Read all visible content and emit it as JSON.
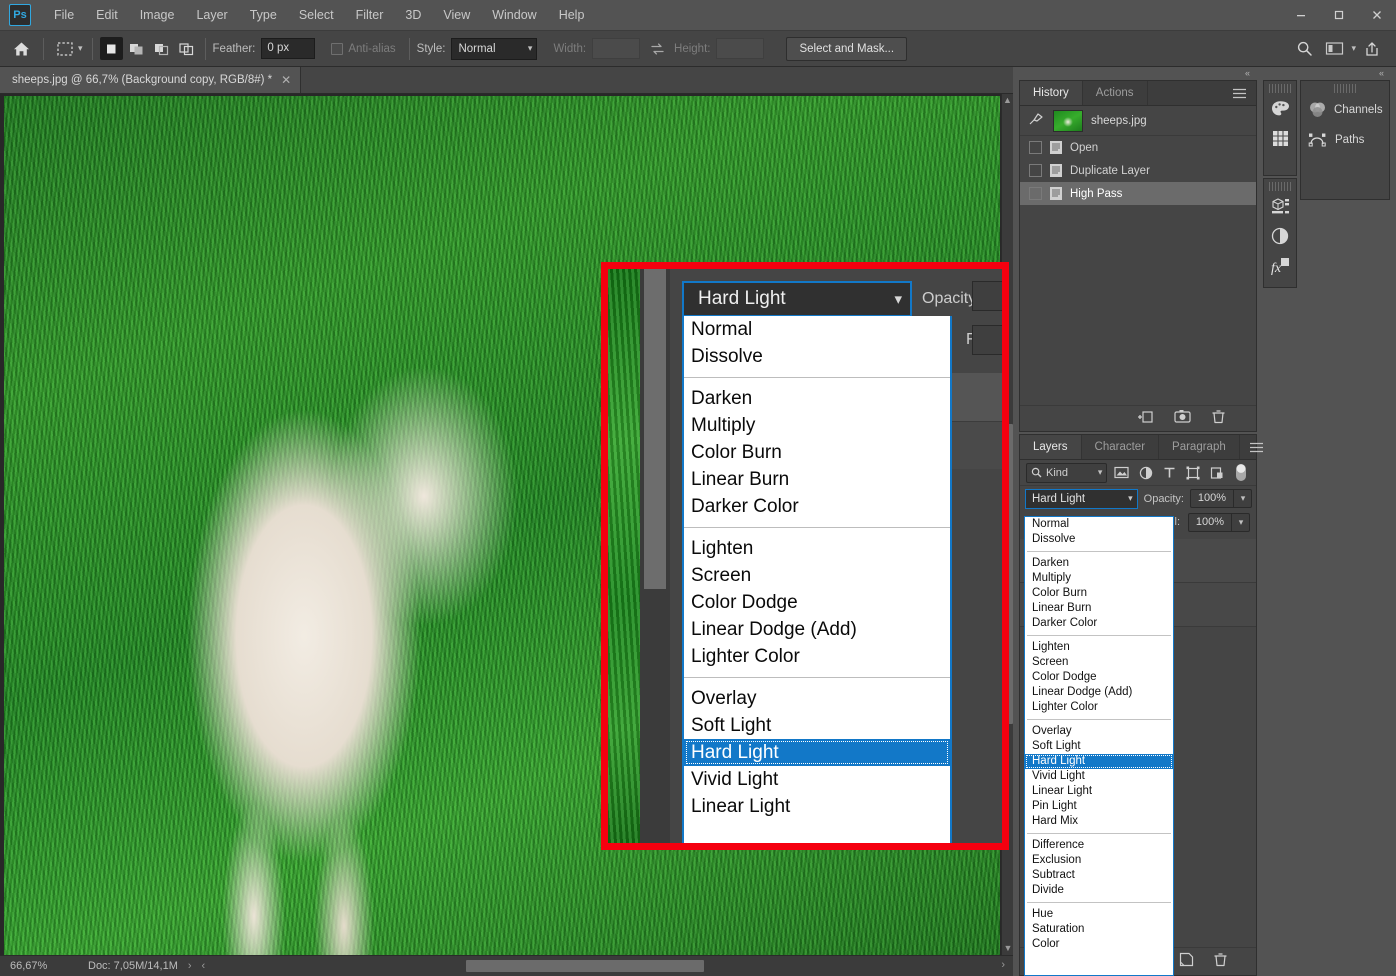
{
  "app": {
    "logo": "Ps"
  },
  "menubar": {
    "items": [
      "File",
      "Edit",
      "Image",
      "Layer",
      "Type",
      "Select",
      "Filter",
      "3D",
      "View",
      "Window",
      "Help"
    ]
  },
  "window_controls": {
    "minimize": "—",
    "maximize": "□",
    "close": "✕"
  },
  "options_bar": {
    "home_icon": "home-icon",
    "tool_icon": "rectangular-marquee-icon",
    "selection_modes": [
      "new-selection",
      "add-to-selection",
      "subtract-from-selection",
      "intersect-with-selection"
    ],
    "feather_label": "Feather:",
    "feather_value": "0 px",
    "antialias_label": "Anti-alias",
    "antialias_checked": false,
    "style_label": "Style:",
    "style_value": "Normal",
    "width_label": "Width:",
    "width_value": "",
    "height_label": "Height:",
    "height_value": "",
    "swap_icon": "swap-dimensions-icon",
    "select_and_mask": "Select and Mask...",
    "right_icons": [
      "search-icon",
      "workspace-arrange-icon",
      "chevron-down-icon",
      "share-icon"
    ]
  },
  "document_tab": {
    "title": "sheeps.jpg @ 66,7% (Background copy, RGB/8#) *",
    "close": "✕"
  },
  "status_bar": {
    "zoom": "66,67%",
    "doc": "Doc: 7,05M/14,1M",
    "expand_arrow": "›",
    "collapse_arrow": "‹",
    "scroll_right_arrow": "›"
  },
  "history_panel": {
    "tabs": [
      {
        "label": "History",
        "active": true
      },
      {
        "label": "Actions",
        "active": false
      }
    ],
    "menu_icon": "panel-menu-icon",
    "snapshot": {
      "label": "sheeps.jpg",
      "brush_icon": "history-brush-icon",
      "thumb": "document-thumbnail"
    },
    "states": [
      {
        "label": "Open",
        "selected": false
      },
      {
        "label": "Duplicate Layer",
        "selected": false
      },
      {
        "label": "High Pass",
        "selected": true
      }
    ],
    "footer_icons": [
      "new-document-from-state-icon",
      "create-snapshot-icon",
      "delete-state-icon"
    ]
  },
  "layers_panel": {
    "tabs": [
      {
        "label": "Layers",
        "active": true
      },
      {
        "label": "Character",
        "active": false
      },
      {
        "label": "Paragraph",
        "active": false
      }
    ],
    "menu_icon": "panel-menu-icon",
    "filter": {
      "kind_label": "Kind",
      "search_icon": "search-icon",
      "chevron": "∨",
      "icons": [
        "filter-pixel-icon",
        "filter-adjustment-icon",
        "filter-type-icon",
        "filter-shape-icon",
        "filter-smart-object-icon"
      ],
      "toggle_icon": "filter-toggle-switch"
    },
    "blend_mode": "Hard Light",
    "blend_chevron": "∨",
    "opacity_label": "Opacity:",
    "opacity_value": "100%",
    "fill_label": "Fill:",
    "fill_value": "100%",
    "lock_icon": "lock-icon",
    "footer_icons": [
      "new-layer-icon",
      "delete-layer-icon"
    ],
    "blend_options": [
      {
        "label": "Normal"
      },
      {
        "label": "Dissolve"
      },
      {
        "separator": true
      },
      {
        "label": "Darken"
      },
      {
        "label": "Multiply"
      },
      {
        "label": "Color Burn"
      },
      {
        "label": "Linear Burn"
      },
      {
        "label": "Darker Color"
      },
      {
        "separator": true
      },
      {
        "label": "Lighten"
      },
      {
        "label": "Screen"
      },
      {
        "label": "Color Dodge"
      },
      {
        "label": "Linear Dodge (Add)"
      },
      {
        "label": "Lighter Color"
      },
      {
        "separator": true
      },
      {
        "label": "Overlay"
      },
      {
        "label": "Soft Light"
      },
      {
        "label": "Hard Light",
        "selected": true
      },
      {
        "label": "Vivid Light"
      },
      {
        "label": "Linear Light"
      },
      {
        "label": "Pin Light"
      },
      {
        "label": "Hard Mix"
      },
      {
        "separator": true
      },
      {
        "label": "Difference"
      },
      {
        "label": "Exclusion"
      },
      {
        "label": "Subtract"
      },
      {
        "label": "Divide"
      },
      {
        "separator": true
      },
      {
        "label": "Hue"
      },
      {
        "label": "Saturation"
      },
      {
        "label": "Color"
      }
    ]
  },
  "collapsed_panels": {
    "tabs": [
      {
        "label": "Channels",
        "icon": "channels-icon"
      },
      {
        "label": "Paths",
        "icon": "paths-icon"
      }
    ],
    "collapse_arrows": "«"
  },
  "icon_rail": {
    "groups": [
      [
        "color-palette-icon",
        "swatches-grid-icon"
      ],
      [
        "3d-properties-icon",
        "adjustments-icon",
        "layer-styles-fx-icon"
      ]
    ]
  },
  "callout": {
    "border_color": "#f5000f",
    "blend_mode": "Hard Light",
    "blend_chevron": "∨",
    "opacity_label": "Opacity:",
    "fill_label": "Fill:",
    "options": [
      {
        "label": "Normal"
      },
      {
        "label": "Dissolve"
      },
      {
        "separator": true
      },
      {
        "label": "Darken"
      },
      {
        "label": "Multiply"
      },
      {
        "label": "Color Burn"
      },
      {
        "label": "Linear Burn"
      },
      {
        "label": "Darker Color"
      },
      {
        "separator": true
      },
      {
        "label": "Lighten"
      },
      {
        "label": "Screen"
      },
      {
        "label": "Color Dodge"
      },
      {
        "label": "Linear Dodge (Add)"
      },
      {
        "label": "Lighter Color"
      },
      {
        "separator": true
      },
      {
        "label": "Overlay"
      },
      {
        "label": "Soft Light"
      },
      {
        "label": "Hard Light",
        "selected": true
      },
      {
        "label": "Vivid Light"
      },
      {
        "label": "Linear Light"
      }
    ]
  }
}
